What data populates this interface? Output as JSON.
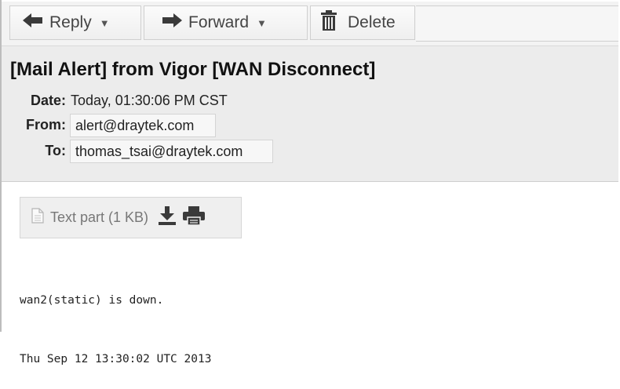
{
  "toolbar": {
    "reply_label": "Reply",
    "forward_label": "Forward",
    "delete_label": "Delete",
    "icons": [
      "arrow-left-icon",
      "chevron-down-icon",
      "arrow-right-icon",
      "trash-icon"
    ]
  },
  "message": {
    "subject": "[Mail Alert] from Vigor [WAN Disconnect]",
    "date_label": "Date:",
    "date_value": "Today, 01:30:06 PM CST",
    "from_label": "From:",
    "from_value": "alert@draytek.com",
    "to_label": "To:",
    "to_value": "thomas_tsai@draytek.com"
  },
  "attachment": {
    "label": "Text part (1 KB)",
    "icons": [
      "document-icon",
      "download-icon",
      "print-icon"
    ]
  },
  "body": {
    "lines": [
      "wan2(static) is down.",
      "Thu Sep 12 13:30:02 UTC 2013"
    ]
  },
  "colors": {
    "toolbar_bg": "#f3f3f3",
    "header_bg": "#ececec",
    "icon_dark": "#3a3a3a"
  }
}
